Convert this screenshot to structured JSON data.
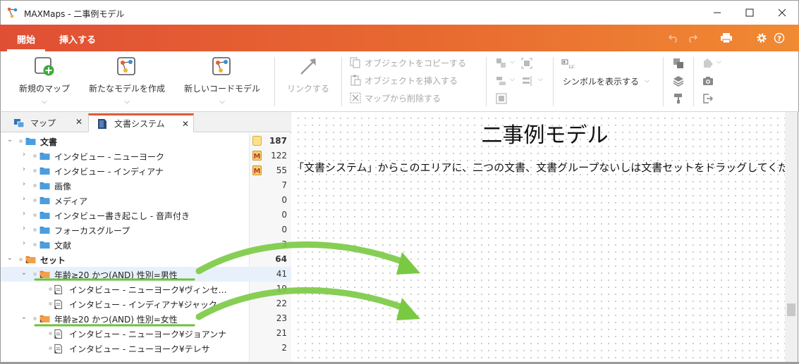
{
  "window": {
    "title": "MAXMaps - 二事例モデル",
    "minimize_icon": "minimize-icon",
    "maximize_icon": "maximize-icon",
    "close_icon": "close-icon"
  },
  "ribbon_tabs": [
    {
      "label": "開始",
      "active": true
    },
    {
      "label": "挿入する",
      "active": false
    }
  ],
  "tabbar_icons": [
    "undo-icon",
    "redo-icon",
    "print-icon",
    "gear-icon",
    "help-icon"
  ],
  "ribbon": {
    "new_map": "新規のマップ",
    "new_model": "新たなモデルを作成",
    "new_code_model": "新しいコードモデル",
    "link": "リンクする",
    "copy_object": "オブジェクトをコピーする",
    "insert_object": "オブジェクトを挿入する",
    "delete_from_map": "マップから削除する",
    "show_symbol": "シンボルを表示する",
    "symbol_badge": "123"
  },
  "panel_tabs": [
    {
      "label": "マップ",
      "active": false
    },
    {
      "label": "文書システム",
      "active": true
    }
  ],
  "tree": [
    {
      "label": "文書",
      "count": "187",
      "bold": true,
      "level": 0,
      "expanded": true,
      "type": "folder",
      "marker": "note"
    },
    {
      "label": "インタビュー - ニューヨーク",
      "count": "122",
      "level": 1,
      "type": "folder",
      "marker": "memo-M"
    },
    {
      "label": "インタビュー - インディアナ",
      "count": "55",
      "level": 1,
      "type": "folder",
      "marker": "memo-M"
    },
    {
      "label": "画像",
      "count": "7",
      "level": 1,
      "type": "folder"
    },
    {
      "label": "メディア",
      "count": "0",
      "level": 1,
      "type": "folder"
    },
    {
      "label": "インタビュー書き起こし - 音声付き",
      "count": "0",
      "level": 1,
      "type": "folder"
    },
    {
      "label": "フォーカスグループ",
      "count": "0",
      "level": 1,
      "type": "folder"
    },
    {
      "label": "文献",
      "count": "3",
      "level": 1,
      "type": "folder"
    },
    {
      "label": "セット",
      "count": "64",
      "bold": true,
      "level": 0,
      "expanded": true,
      "type": "set"
    },
    {
      "label": "年齢≥20 かつ(AND) 性別=男性",
      "count": "41",
      "level": 1,
      "expanded": true,
      "type": "set",
      "selected": true
    },
    {
      "label": "インタビュー - ニューヨーク¥ヴィンセ…",
      "count": "19",
      "level": 2,
      "type": "doc"
    },
    {
      "label": "インタビュー - インディアナ¥ジャック",
      "count": "22",
      "level": 2,
      "type": "doc"
    },
    {
      "label": "年齢≥20 かつ(AND) 性別=女性",
      "count": "23",
      "level": 1,
      "expanded": true,
      "type": "set"
    },
    {
      "label": "インタビュー - ニューヨーク¥ジョアンナ",
      "count": "21",
      "level": 2,
      "type": "doc"
    },
    {
      "label": "インタビュー - ニューヨーク¥テレサ",
      "count": "2",
      "level": 2,
      "type": "doc"
    }
  ],
  "canvas": {
    "title": "二事例モデル",
    "instruction": "「文書システム」からこのエリアに、二つの文書、文書グループないしは文書セットをドラッグしてください。"
  },
  "colors": {
    "accent_orange": "#e8602f",
    "folder_blue": "#3b8fd0",
    "set_orange": "#f08c3a",
    "annotation_green": "#6cc23a"
  }
}
